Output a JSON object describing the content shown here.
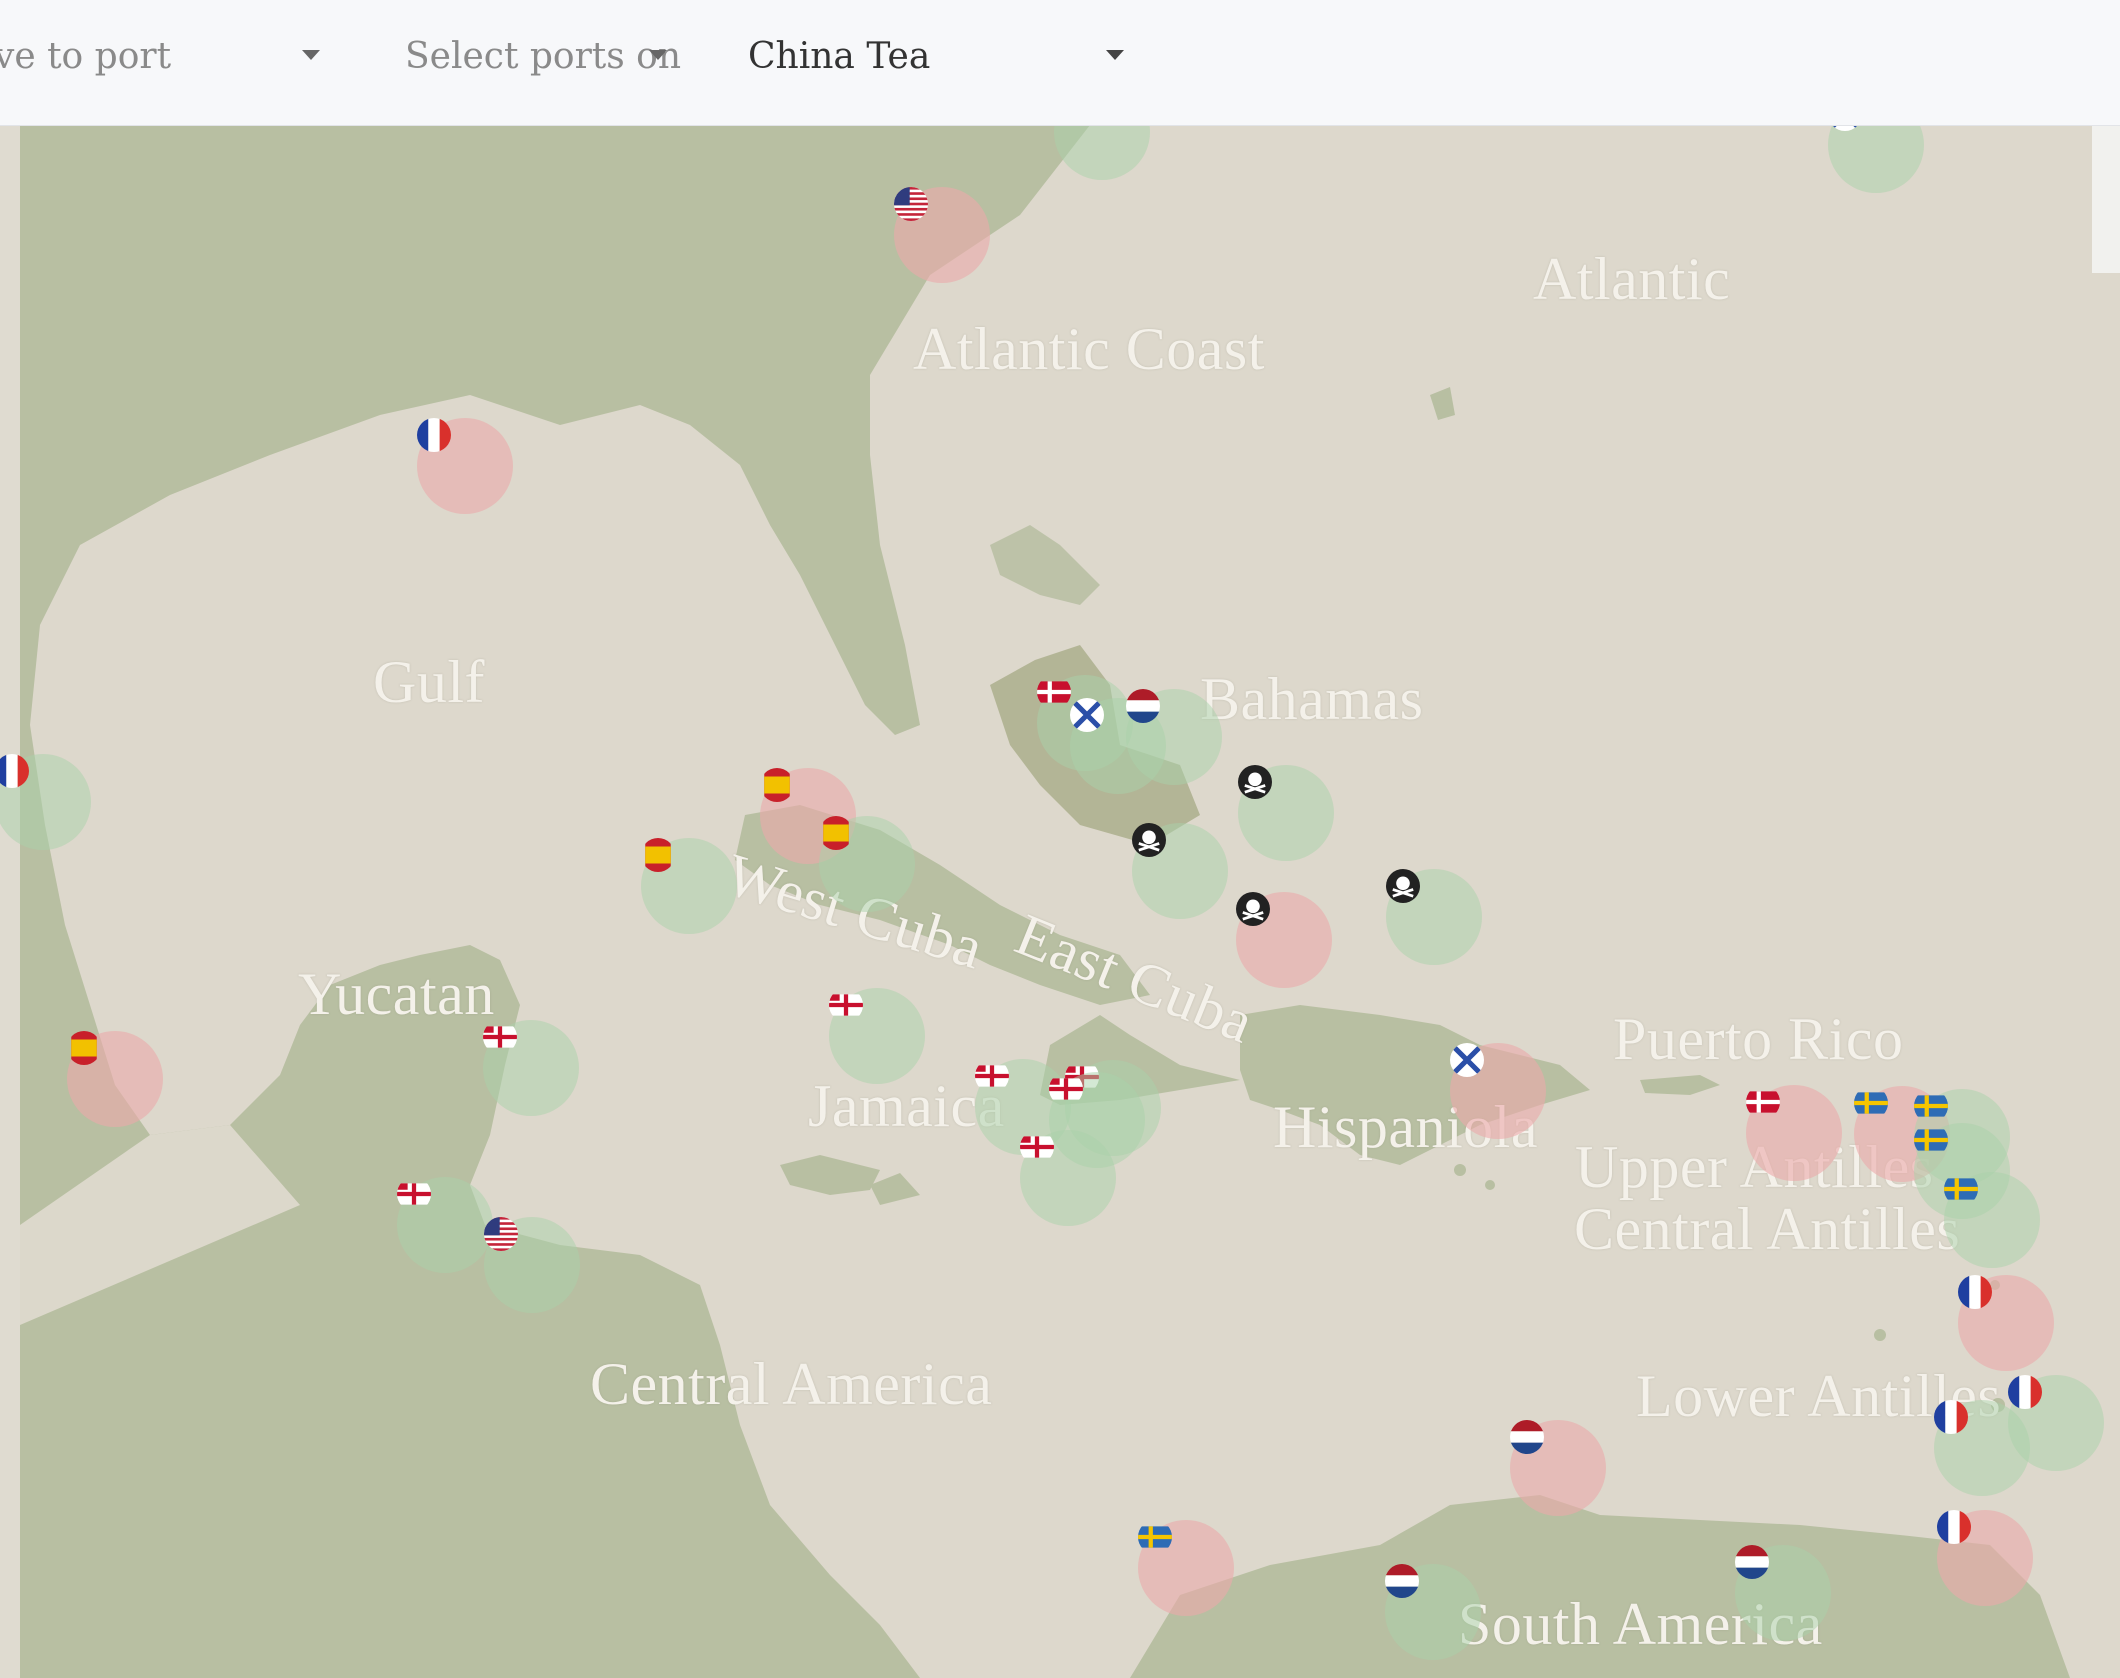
{
  "toolbar": {
    "move_to_port": "ve to port",
    "select_ports_on": "Select ports on",
    "selected_good": "China Tea"
  },
  "regions": [
    {
      "id": "atlantic",
      "label": "Atlantic"
    },
    {
      "id": "atlantic-coast",
      "label": "Atlantic Coast"
    },
    {
      "id": "gulf",
      "label": "Gulf"
    },
    {
      "id": "bahamas",
      "label": "Bahamas"
    },
    {
      "id": "west-cuba",
      "label": "West Cuba"
    },
    {
      "id": "east-cuba",
      "label": "East Cuba"
    },
    {
      "id": "yucatan",
      "label": "Yucatan"
    },
    {
      "id": "jamaica",
      "label": "Jamaica"
    },
    {
      "id": "puerto-rico",
      "label": "Puerto Rico"
    },
    {
      "id": "hispaniola",
      "label": "Hispaniola"
    },
    {
      "id": "upper-antilles",
      "label": "Upper Antilles"
    },
    {
      "id": "central-antilles",
      "label": "Central Antilles"
    },
    {
      "id": "lower-antilles",
      "label": "Lower Antilles"
    },
    {
      "id": "central-america",
      "label": "Central America"
    },
    {
      "id": "south-america",
      "label": "South America"
    }
  ],
  "colors": {
    "water": "#ddd8cc",
    "land": "#b8bfa2",
    "port_buy": "#aad2aa",
    "port_sell": "#ebaaaa"
  }
}
